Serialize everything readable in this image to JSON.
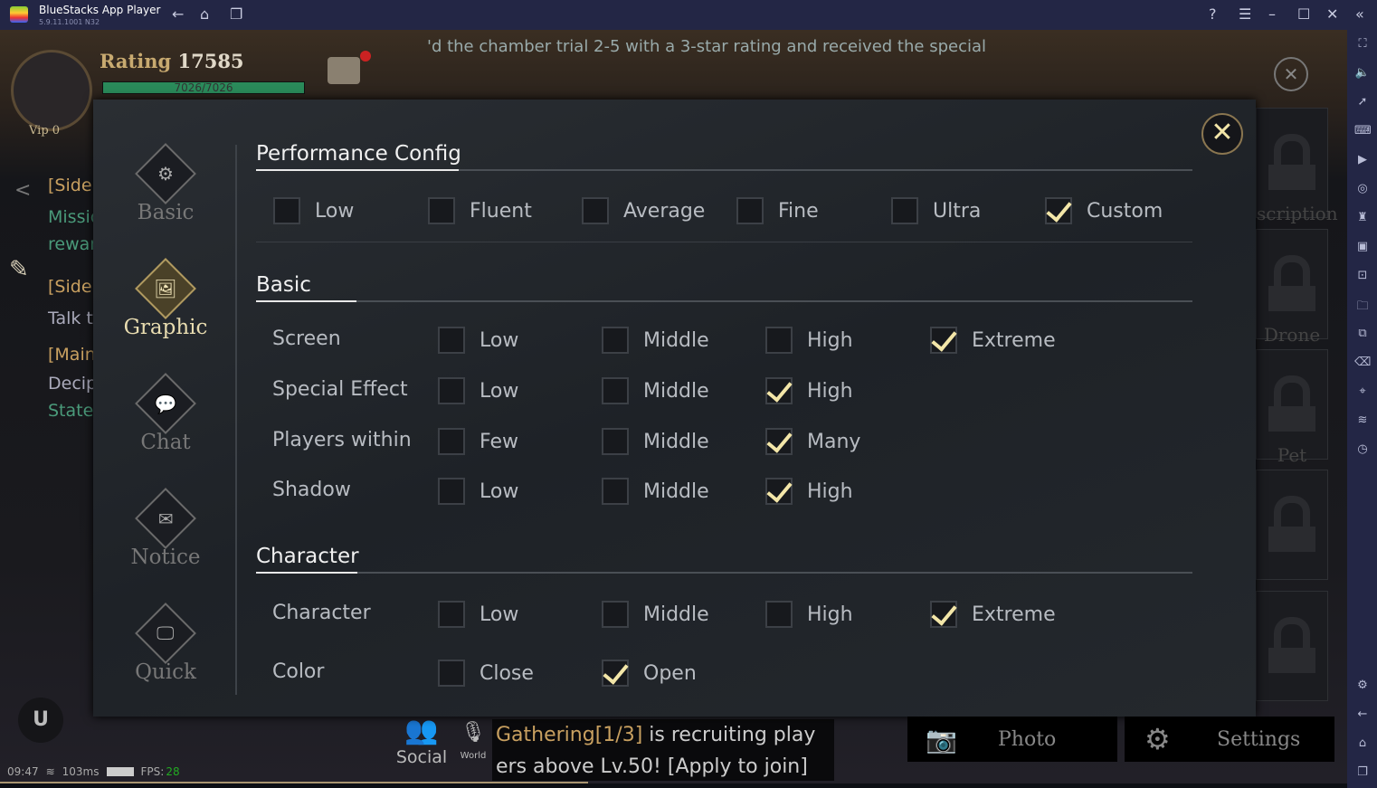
{
  "app": {
    "title": "BlueStacks App Player",
    "version": "5.9.11.1001 N32"
  },
  "titlebar_icons": [
    "back-icon",
    "home-icon",
    "multi-instance-icon",
    "help-icon",
    "menu-icon",
    "minimize-icon",
    "maximize-icon",
    "close-icon",
    "collapse-icon"
  ],
  "sidebar_icons": [
    "fullscreen-icon",
    "volume-icon",
    "pointer-icon",
    "keyboard-icon",
    "macro-icon",
    "rotate-sync-icon",
    "gamepad-icon",
    "apk-icon",
    "screenshot-icon",
    "folder-icon",
    "resize-icon",
    "erase-icon",
    "location-icon",
    "layers-icon",
    "performance-icon",
    "settings-icon",
    "back-icon",
    "home-icon",
    "recent-apps-icon"
  ],
  "hud": {
    "rating_label": "Rating",
    "rating": "17585",
    "hp": "7026/7026",
    "hp_fraction": 1.0,
    "vip": "Vip 0",
    "banner": "'d the chamber trial 2-5 with a 3-star rating and received the special",
    "quests": [
      "[Side",
      "Missio",
      "rewar",
      "[Side]",
      "Talk t",
      "[Main]",
      "Decip",
      "State"
    ],
    "locks": [
      "scription",
      "Drone",
      "Pet"
    ],
    "time": "09:47",
    "ping": "103ms",
    "fps_label": "FPS:",
    "fps": "28",
    "social": "Social",
    "world": "World",
    "chat_highlight": "Gathering[1/3]",
    "chat_text": " is recruiting play",
    "chat_text2": "ers above Lv.50! [Apply to join]",
    "photo": "Photo",
    "settings": "Settings"
  },
  "nav": [
    {
      "label": "Basic",
      "icon": "gears-icon"
    },
    {
      "label": "Graphic",
      "icon": "image-icon",
      "active": true
    },
    {
      "label": "Chat",
      "icon": "chat-icon"
    },
    {
      "label": "Notice",
      "icon": "mail-icon"
    },
    {
      "label": "Quick",
      "icon": "monitor-icon"
    }
  ],
  "performance": {
    "title": "Performance Config",
    "options": [
      {
        "label": "Low",
        "checked": false
      },
      {
        "label": "Fluent",
        "checked": false
      },
      {
        "label": "Average",
        "checked": false
      },
      {
        "label": "Fine",
        "checked": false
      },
      {
        "label": "Ultra",
        "checked": false
      },
      {
        "label": "Custom",
        "checked": true
      }
    ]
  },
  "basic": {
    "title": "Basic",
    "rows": [
      {
        "label": "Screen",
        "options": [
          {
            "label": "Low",
            "checked": false
          },
          {
            "label": "Middle",
            "checked": false
          },
          {
            "label": "High",
            "checked": false
          },
          {
            "label": "Extreme",
            "checked": true
          }
        ]
      },
      {
        "label": "Special Effect",
        "options": [
          {
            "label": "Low",
            "checked": false
          },
          {
            "label": "Middle",
            "checked": false
          },
          {
            "label": "High",
            "checked": true
          }
        ]
      },
      {
        "label": "Players within",
        "options": [
          {
            "label": "Few",
            "checked": false
          },
          {
            "label": "Middle",
            "checked": false
          },
          {
            "label": "Many",
            "checked": true
          }
        ]
      },
      {
        "label": "Shadow",
        "options": [
          {
            "label": "Low",
            "checked": false
          },
          {
            "label": "Middle",
            "checked": false
          },
          {
            "label": "High",
            "checked": true
          }
        ]
      }
    ]
  },
  "character": {
    "title": "Character",
    "rows": [
      {
        "label": "Character",
        "options": [
          {
            "label": "Low",
            "checked": false
          },
          {
            "label": "Middle",
            "checked": false
          },
          {
            "label": "High",
            "checked": false
          },
          {
            "label": "Extreme",
            "checked": true
          }
        ]
      },
      {
        "label": "Color",
        "options": [
          {
            "label": "Close",
            "checked": false
          },
          {
            "label": "Open",
            "checked": true
          }
        ]
      }
    ]
  }
}
